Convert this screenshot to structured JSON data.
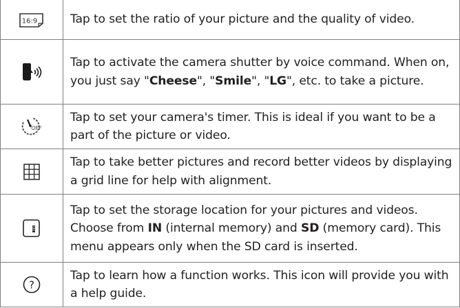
{
  "rows": [
    {
      "icon": "ratio-16-9-icon",
      "icon_label": "16:9",
      "text": [
        "Tap to set the ratio of your picture and the quality of video."
      ]
    },
    {
      "icon": "voice-shutter-icon",
      "text": [
        "Tap to activate the camera shutter by voice command. When on, you just say \"",
        "Cheese",
        "\", \"",
        "Smile",
        "\", \"",
        "LG",
        "\", etc. to take a picture."
      ]
    },
    {
      "icon": "timer-off-icon",
      "icon_label": "OFF",
      "text": [
        "Tap to set your camera's timer. This is ideal if you want to be a part of the picture or video."
      ]
    },
    {
      "icon": "grid-icon",
      "text": [
        "Tap to take better pictures and record better videos by displaying a grid line for help with alignment."
      ]
    },
    {
      "icon": "storage-card-icon",
      "text": [
        "Tap to set the storage location for your pictures and videos. Choose from ",
        "IN",
        " (internal memory) and ",
        "SD",
        " (memory card). This menu appears only when the SD card is inserted."
      ]
    },
    {
      "icon": "help-icon",
      "icon_label": "?",
      "text": [
        "Tap to learn how a function works. This icon will provide you with a help guide."
      ]
    }
  ]
}
